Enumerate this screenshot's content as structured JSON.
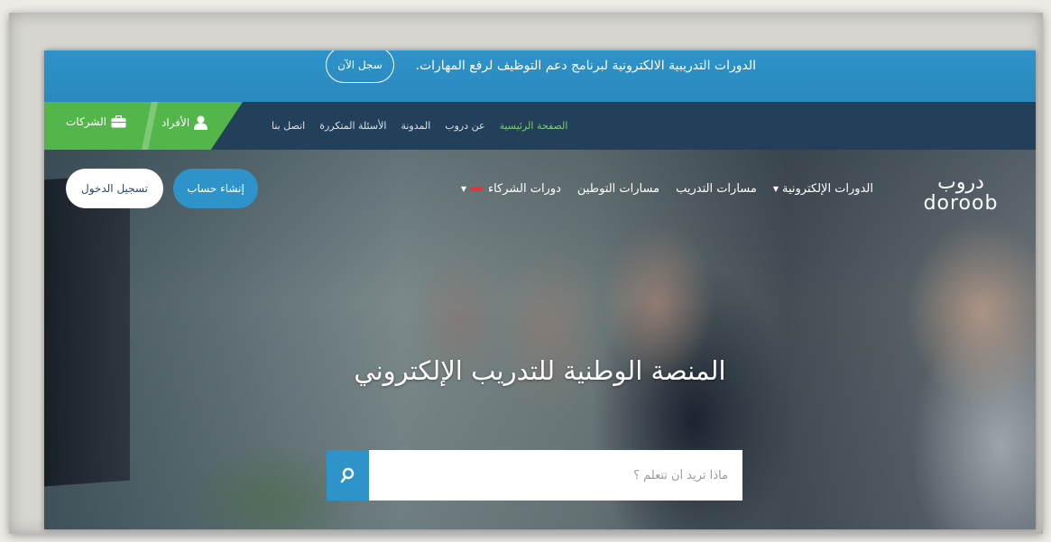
{
  "announcement": {
    "text": "الدورات التدريبية الالكترونية لبرنامج دعم التوظيف لرفع المهارات.",
    "cta": "سجل الآن"
  },
  "top_nav": {
    "individuals": "الأفراد",
    "companies": "الشركات",
    "links": [
      "الصفحة الرئيسية",
      "عن دروب",
      "المدونة",
      "الأسئلة المتكررة",
      "اتصل بنا"
    ],
    "active_link": "الصفحة الرئيسية"
  },
  "logo": {
    "arabic": "دروب",
    "latin": "doroob"
  },
  "main_nav": {
    "items": [
      "الدورات الإلكترونية",
      "مسارات التدريب",
      "مسارات التوطين",
      "دورات الشركاء"
    ]
  },
  "auth": {
    "login": "تسجيل الدخول",
    "signup": "إنشاء حساب"
  },
  "hero": {
    "title": "المنصة الوطنية للتدريب الإلكتروني",
    "search_placeholder": "ماذا تريد أن تتعلم ؟"
  },
  "colors": {
    "primary_blue": "#2e93c9",
    "green": "#53b64a",
    "navy": "#22405a",
    "badge_red": "#e0353f"
  }
}
